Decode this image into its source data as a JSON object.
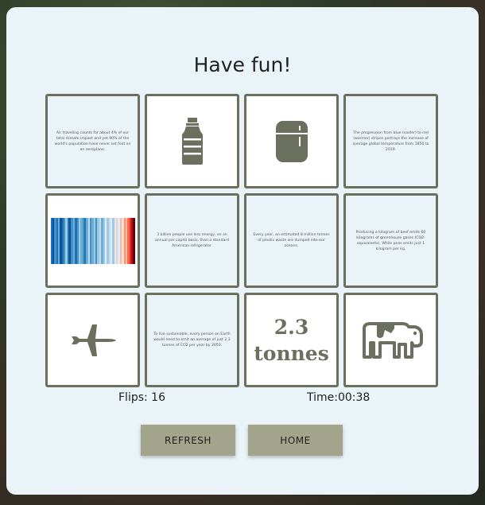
{
  "game": {
    "title": "Have fun!",
    "flips": "Flips: 16",
    "time": "Time:00:38",
    "refresh_label": "REFRESH",
    "home_label": "HOME"
  },
  "cards": {
    "c1": "Air traveling counts for about 4% of our total climate impact and yet 90% of the world's population have never set foot on an aeroplane.",
    "c4": "The progression from blue (cooler) to red (warmer) stripes portrays the increase of average global temperature from 1850 to 2019.",
    "c6": "3 billion people use less energy, on an annual per capita basis, than a standard American refrigerator.",
    "c7": "Every year, an estimated 8 million tonnes of plastic waste are dumped into our oceans.",
    "c8": "Producing a kilogram of beef emits 60 kilograms of greenhouse gases (CO2-equivalents). While peas emits just 1 kilogram per kg.",
    "c10": "To live sustainable, every person on Earth would need to emit an average of just 2.3 tonnes of CO2 per year by 2050.",
    "c11_line1": "2.3",
    "c11_line2": "tonnes"
  },
  "icons": {
    "c2": "plastic-bottle-icon",
    "c3": "refrigerator-icon",
    "c5": "warming-stripes-image",
    "c9": "airplane-icon",
    "c12": "cow-icon"
  },
  "colors": {
    "card_border": "#6b6f5e",
    "icon": "#6b6f5e",
    "button": "#a2a48c",
    "panel": "#eaf3f7"
  }
}
